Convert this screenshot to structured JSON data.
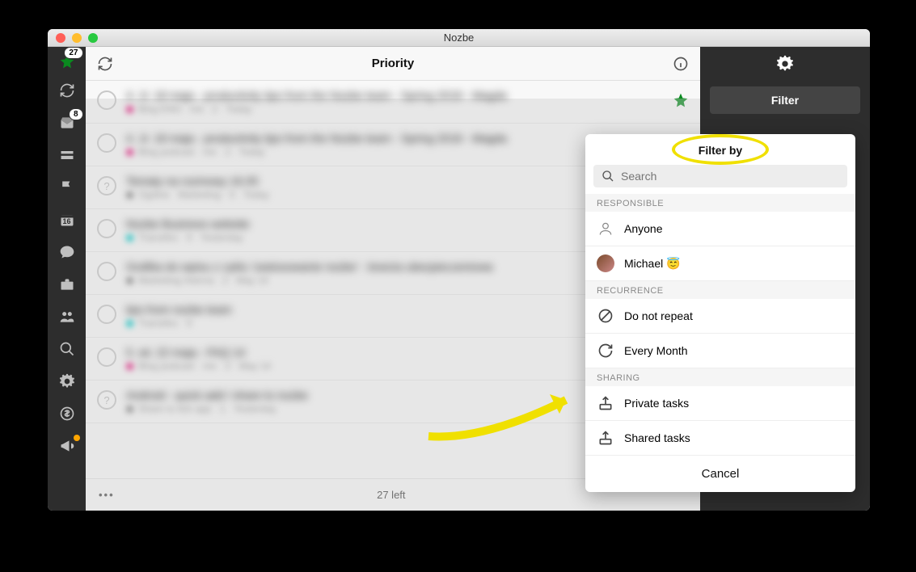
{
  "window": {
    "title": "Nozbe"
  },
  "toolbar": {
    "title": "Priority"
  },
  "sidebar": {
    "priority_badge": "27",
    "inbox_badge": "8",
    "calendar_day": "16"
  },
  "rightpanel": {
    "filter_label": "Filter"
  },
  "tasks": [
    {
      "num": "4.",
      "title": "Jr. 18 maja - productivity tips from the Nozbe team - Spring 2018 - Magda",
      "dot": "magenta",
      "meta": "Blog ENG · me · 2 · Today",
      "star": true
    },
    {
      "num": "4.",
      "title": "Jr. 18 maja - productivity tips from the Nozbe team - Spring 2018 - Magda",
      "dot": "magenta",
      "meta": "Blog podcast · me · 2 · Today"
    },
    {
      "num": "",
      "title": "Tematy na rozmowy 16.05",
      "dot": "grey",
      "meta": "Ogólne · Marketing · 0 · Today",
      "q": true
    },
    {
      "num": "",
      "title": "Nozbe Business website",
      "dot": "teal",
      "meta": "Transifex · 0 · Yesterday"
    },
    {
      "num": "",
      "title": "Grafika do wpisu z cyklu 'zastosowanie nozbe' - branża ubezpieczeniowa",
      "dot": "grey",
      "meta": "Marketing Interna · 2 · May 14"
    },
    {
      "num": "",
      "title": "tips from nozbe team",
      "dot": "teal",
      "meta": "Transifex · 0"
    },
    {
      "num": "5.",
      "title": "wt. 22 maja - FAQ 14",
      "dot": "magenta",
      "meta": "Blog podcast · me · 2 · May 14"
    },
    {
      "num": "",
      "title": "Android - quick add / share to nozbe",
      "dot": "grey",
      "meta": "Share to tick app · 1 · Yesterday",
      "q": true
    }
  ],
  "footer": {
    "count": "27 left"
  },
  "popup": {
    "title": "Filter by",
    "search_placeholder": "Search",
    "sections": {
      "responsible": "RESPONSIBLE",
      "recurrence": "RECURRENCE",
      "sharing": "SHARING"
    },
    "anyone": "Anyone",
    "michael": "Michael 😇",
    "dnr": "Do not repeat",
    "every_month": "Every Month",
    "private": "Private tasks",
    "shared": "Shared tasks",
    "cancel": "Cancel"
  }
}
